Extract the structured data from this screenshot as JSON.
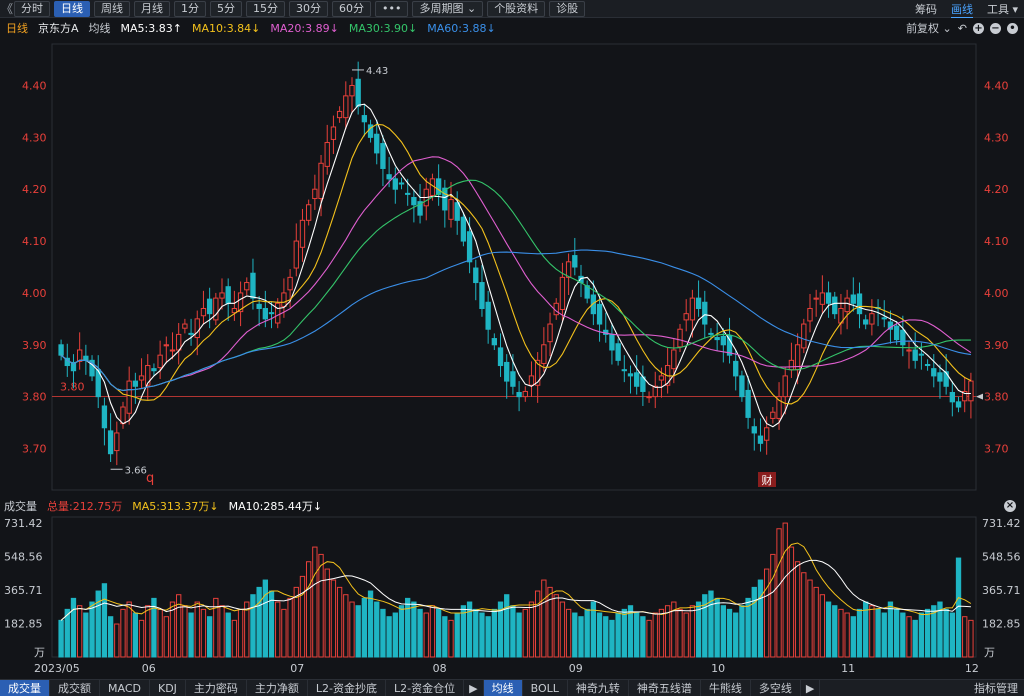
{
  "toolbar": {
    "back": "《",
    "periods": [
      "分时",
      "日线",
      "周线",
      "月线",
      "1分",
      "5分",
      "15分",
      "30分",
      "60分"
    ],
    "active_period": "日线",
    "more": "•••",
    "multi_period": "多周期图",
    "stock_info": "个股资料",
    "diagnose": "诊股",
    "right": {
      "chips": "筹码",
      "draw": "画线",
      "tools": "工具"
    }
  },
  "legend": {
    "period": "日线",
    "name": "京东方A",
    "avg": "均线",
    "ma5": "MA5:3.83↑",
    "ma10": "MA10:3.84↓",
    "ma20": "MA20:3.89↓",
    "ma30": "MA30:3.90↓",
    "ma60": "MA60:3.88↓",
    "adjust": "前复权"
  },
  "vol_legend": {
    "title": "成交量",
    "total": "总量:212.75万",
    "ma5": "MA5:313.37万↓",
    "ma10": "MA10:285.44万↓"
  },
  "colors": {
    "up": "#e8403a",
    "down": "#1fb5c3",
    "ma5": "#ffffff",
    "ma10": "#f3c11c",
    "ma20": "#e05fd0",
    "ma30": "#34c46a",
    "ma60": "#3a8fe8"
  },
  "price_axis": [
    "4.40",
    "4.30",
    "4.20",
    "4.10",
    "4.00",
    "3.90",
    "3.80",
    "3.70"
  ],
  "price_range": [
    3.62,
    4.48
  ],
  "vol_axis": [
    "731.42",
    "548.56",
    "365.71",
    "182.85"
  ],
  "vol_unit": "万",
  "vol_max": 731.42,
  "annotations": {
    "high": "4.43",
    "low": "3.66",
    "ref_line": "3.80",
    "marker_q": "q",
    "marker_cai": "财"
  },
  "months": [
    "2023/05",
    "06",
    "07",
    "08",
    "09",
    "10",
    "11",
    "12"
  ],
  "bottom_tabs": [
    "成交量",
    "成交额",
    "MACD",
    "KDJ",
    "主力密码",
    "主力净额",
    "L2-资金抄底",
    "L2-资金仓位",
    "▶",
    "均线",
    "BOLL",
    "神奇九转",
    "神奇五线谱",
    "牛熊线",
    "多空线",
    "▶"
  ],
  "bottom_right": "指标管理",
  "chart_data": {
    "type": "candlestick",
    "title": "京东方A 日线",
    "series_close": [
      3.88,
      3.86,
      3.85,
      3.89,
      3.87,
      3.84,
      3.8,
      3.74,
      3.69,
      3.73,
      3.78,
      3.83,
      3.82,
      3.84,
      3.86,
      3.85,
      3.88,
      3.9,
      3.89,
      3.92,
      3.94,
      3.92,
      3.95,
      3.97,
      3.96,
      3.99,
      4.0,
      3.98,
      3.97,
      4.0,
      4.02,
      3.99,
      3.97,
      3.95,
      3.96,
      3.98,
      4.0,
      4.03,
      4.1,
      4.14,
      4.17,
      4.2,
      4.25,
      4.29,
      4.32,
      4.35,
      4.38,
      4.4,
      4.36,
      4.33,
      4.3,
      4.27,
      4.24,
      4.22,
      4.2,
      4.21,
      4.19,
      4.17,
      4.15,
      4.2,
      4.22,
      4.19,
      4.16,
      4.18,
      4.14,
      4.1,
      4.06,
      4.02,
      3.97,
      3.93,
      3.9,
      3.86,
      3.83,
      3.82,
      3.8,
      3.81,
      3.84,
      3.87,
      3.9,
      3.94,
      3.98,
      4.03,
      4.06,
      4.05,
      4.02,
      3.99,
      3.96,
      3.94,
      3.92,
      3.89,
      3.87,
      3.85,
      3.84,
      3.82,
      3.81,
      3.8,
      3.82,
      3.84,
      3.86,
      3.89,
      3.93,
      3.96,
      3.99,
      3.97,
      3.94,
      3.92,
      3.91,
      3.9,
      3.88,
      3.84,
      3.8,
      3.76,
      3.73,
      3.71,
      3.74,
      3.77,
      3.8,
      3.84,
      3.87,
      3.9,
      3.94,
      3.97,
      3.99,
      4.0,
      3.98,
      3.96,
      3.97,
      3.99,
      3.98,
      3.96,
      3.94,
      3.96,
      3.97,
      3.95,
      3.93,
      3.91,
      3.9,
      3.89,
      3.87,
      3.88,
      3.86,
      3.84,
      3.83,
      3.82,
      3.79,
      3.78,
      3.81,
      3.83
    ],
    "volume": [
      200,
      260,
      320,
      280,
      240,
      300,
      360,
      400,
      220,
      180,
      260,
      300,
      240,
      200,
      280,
      320,
      260,
      220,
      300,
      340,
      280,
      240,
      300,
      260,
      220,
      320,
      280,
      240,
      200,
      260,
      300,
      340,
      380,
      420,
      360,
      300,
      260,
      320,
      380,
      440,
      520,
      600,
      560,
      480,
      420,
      380,
      340,
      300,
      280,
      320,
      360,
      300,
      260,
      220,
      240,
      280,
      320,
      300,
      260,
      240,
      280,
      260,
      220,
      200,
      240,
      280,
      300,
      260,
      240,
      220,
      260,
      300,
      340,
      280,
      240,
      260,
      300,
      360,
      420,
      380,
      340,
      300,
      260,
      240,
      220,
      260,
      300,
      240,
      220,
      200,
      240,
      260,
      280,
      240,
      220,
      200,
      240,
      260,
      280,
      300,
      260,
      240,
      280,
      300,
      340,
      360,
      320,
      280,
      260,
      240,
      280,
      320,
      380,
      420,
      480,
      560,
      700,
      731,
      600,
      520,
      460,
      420,
      380,
      340,
      300,
      280,
      260,
      240,
      220,
      260,
      300,
      280,
      260,
      240,
      300,
      260,
      240,
      220,
      200,
      240,
      260,
      280,
      300,
      260,
      240,
      540,
      220,
      200
    ]
  }
}
